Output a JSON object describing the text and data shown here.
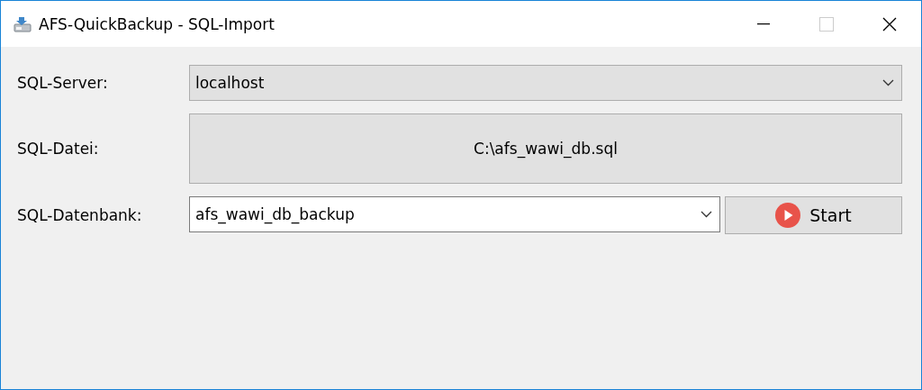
{
  "window": {
    "title": "AFS-QuickBackup - SQL-Import"
  },
  "server": {
    "label": "SQL-Server:",
    "value": "localhost"
  },
  "file": {
    "label": "SQL-Datei:",
    "value": "C:\\afs_wawi_db.sql"
  },
  "database": {
    "label": "SQL-Datenbank:",
    "value": "afs_wawi_db_backup"
  },
  "start_button": {
    "label": "Start"
  }
}
